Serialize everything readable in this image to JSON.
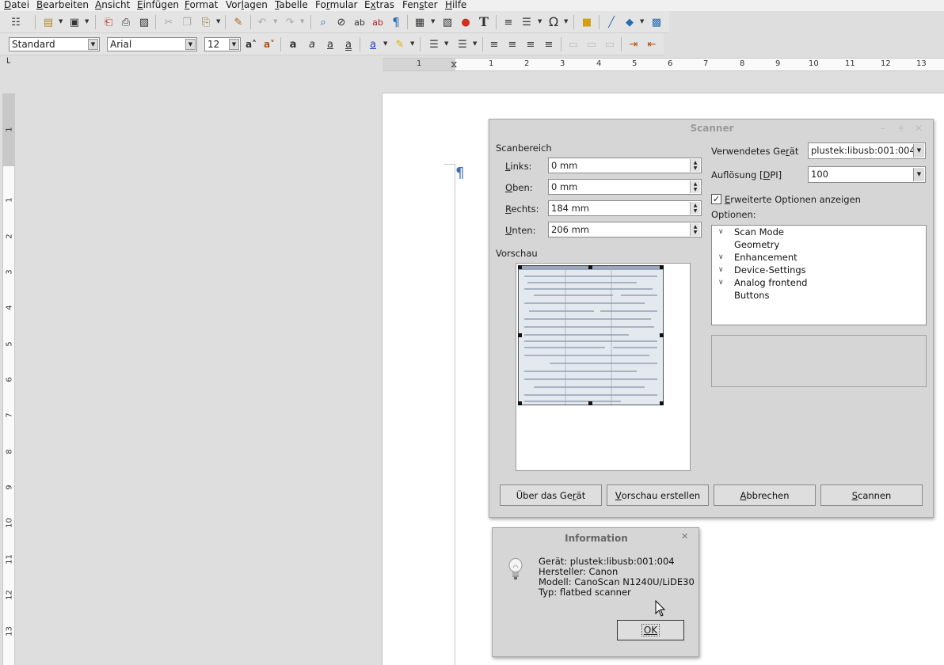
{
  "menubar": {
    "items": [
      {
        "pre": "",
        "u": "D",
        "post": "atei"
      },
      {
        "pre": "",
        "u": "B",
        "post": "earbeiten"
      },
      {
        "pre": "",
        "u": "A",
        "post": "nsicht"
      },
      {
        "pre": "",
        "u": "E",
        "post": "infügen"
      },
      {
        "pre": "",
        "u": "F",
        "post": "ormat"
      },
      {
        "pre": "Vor",
        "u": "l",
        "post": "agen"
      },
      {
        "pre": "",
        "u": "T",
        "post": "abelle"
      },
      {
        "pre": "Fo",
        "u": "r",
        "post": "mular"
      },
      {
        "pre": "E",
        "u": "x",
        "post": "tras"
      },
      {
        "pre": "Fen",
        "u": "s",
        "post": "ter"
      },
      {
        "pre": "",
        "u": "H",
        "post": "ilfe"
      }
    ]
  },
  "formatting": {
    "paragraph_style": "Standard",
    "font_name": "Arial",
    "font_size": "12"
  },
  "ruler": {
    "h_numbers": [
      "1",
      "1",
      "2",
      "3",
      "4",
      "5",
      "6",
      "7",
      "8",
      "9",
      "10",
      "11",
      "12",
      "13"
    ],
    "v_numbers": [
      "1",
      "1",
      "2",
      "3",
      "4",
      "5",
      "6",
      "7",
      "8",
      "9",
      "10",
      "11",
      "12",
      "13"
    ]
  },
  "document": {
    "pilcrow": "¶"
  },
  "scanner": {
    "title": "Scanner",
    "scan_area_label": "Scanbereich",
    "fields": [
      {
        "u": "L",
        "post": "inks:",
        "value": "0 mm"
      },
      {
        "u": "O",
        "post": "ben:",
        "value": "0 mm"
      },
      {
        "u": "R",
        "post": "echts:",
        "value": "184 mm"
      },
      {
        "u": "U",
        "post": "nten:",
        "value": "206 mm"
      }
    ],
    "preview_label": "Vorschau",
    "device_label_pre": "Verwendetes Ge",
    "device_label_u": "r",
    "device_label_post": "ät",
    "device_value": "plustek:libusb:001:004",
    "resolution_label_pre": "Auflösung [",
    "resolution_label_u": "D",
    "resolution_label_post": "PI]",
    "resolution_value": "100",
    "advanced_u": "E",
    "advanced_post": "rweiterte Optionen anzeigen",
    "advanced_checked": true,
    "options_label": "Optionen:",
    "options": [
      {
        "label": "Scan Mode",
        "expanded": true
      },
      {
        "label": "Geometry",
        "expanded": false
      },
      {
        "label": "Enhancement",
        "expanded": true
      },
      {
        "label": "Device-Settings",
        "expanded": true
      },
      {
        "label": "Analog frontend",
        "expanded": true
      },
      {
        "label": "Buttons",
        "expanded": false
      }
    ],
    "buttons": [
      {
        "pre": "Über das Ge",
        "u": "r",
        "post": "ät"
      },
      {
        "pre": "",
        "u": "V",
        "post": "orschau erstellen"
      },
      {
        "pre": "",
        "u": "A",
        "post": "bbrechen"
      },
      {
        "pre": "",
        "u": "S",
        "post": "cannen"
      }
    ]
  },
  "info": {
    "title": "Information",
    "lines": [
      "Gerät: plustek:libusb:001:004",
      "Hersteller: Canon",
      "Modell: CanoScan N1240U/LiDE30",
      "Typ: flatbed scanner"
    ],
    "ok": "OK"
  },
  "colors": {
    "pilcrow": "#3b6cb4",
    "dialog_bg": "#d6d6d6",
    "toolbar_bg": "#e4e4e4"
  }
}
